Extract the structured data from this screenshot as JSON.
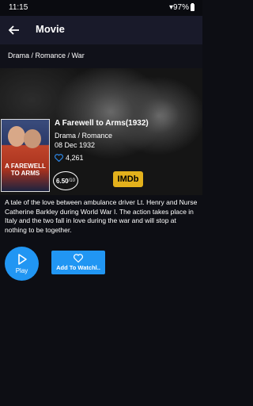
{
  "status": {
    "time": "11:15",
    "battery": "97%"
  },
  "appbar": {
    "title": "Movie",
    "back_icon": "arrow-left-icon"
  },
  "genre_bar": {
    "text": "Drama / Romance / War"
  },
  "movie": {
    "poster_title": "A Farewell to Arms",
    "title": "A Farewell to Arms(1932)",
    "genres": "Drama / Romance",
    "release_date": "08 Dec 1932",
    "likes": "4,261",
    "rating": "6.50",
    "rating_scale": "/10",
    "imdb_label": "IMDb",
    "description": "A tale of the love between ambulance driver Lt. Henry and Nurse Catherine Barkley during World War I. The action takes place in Italy and the two fall in love during the war and will stop at nothing to be together."
  },
  "actions": {
    "play_label": "Play",
    "watchlist_label": "Add To Watchl.."
  },
  "colors": {
    "accent": "#2196f3",
    "appbar": "#191a2a",
    "imdb": "#e3b11c",
    "background": "#0d0e14"
  }
}
